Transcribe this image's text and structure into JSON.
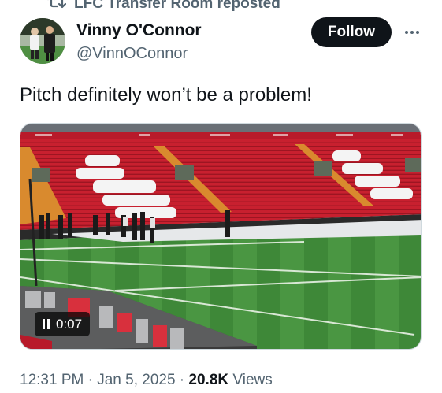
{
  "repost": {
    "label": "LFC Transfer Room reposted"
  },
  "author": {
    "display_name": "Vinny O'Connor",
    "handle": "@VinnOConnor"
  },
  "actions": {
    "follow_label": "Follow"
  },
  "post": {
    "text": "Pitch definitely won’t be a problem!"
  },
  "video": {
    "time": "0:07",
    "state": "playing"
  },
  "meta": {
    "time": "12:31 PM",
    "sep1": " · ",
    "date": "Jan 5, 2025",
    "sep2": " · ",
    "views_count": "20.8K",
    "views_label": " Views"
  },
  "colors": {
    "follow_bg": "#0f1419",
    "secondary_text": "#536471",
    "seat_red": "#c8202f",
    "pitch_green": "#3f8a3a"
  }
}
